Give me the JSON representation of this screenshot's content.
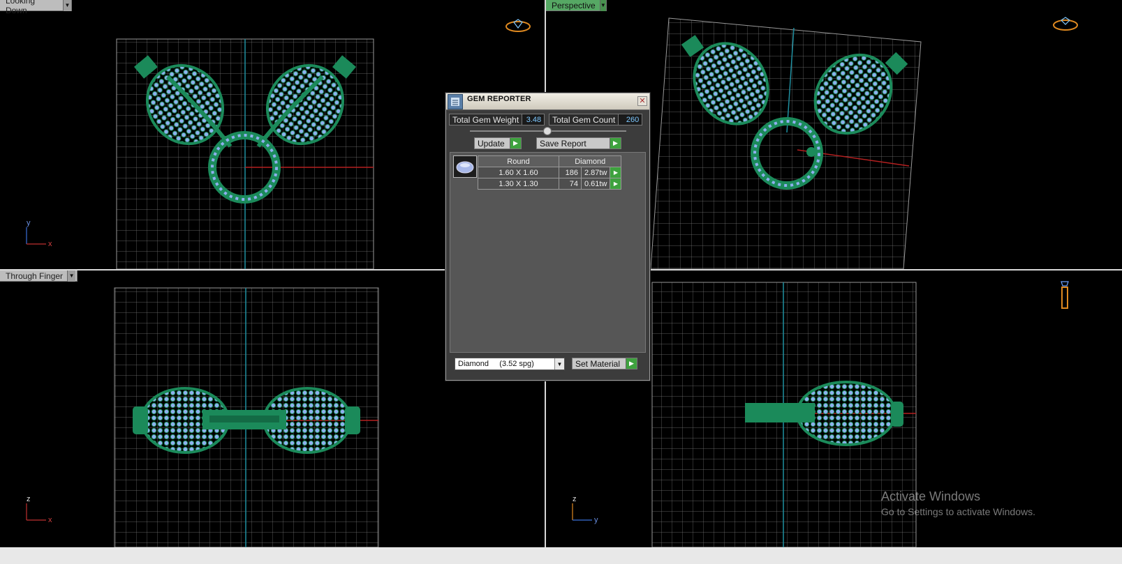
{
  "viewports": {
    "top_left": {
      "label": "Looking Down",
      "axes": {
        "vertical": "y",
        "horizontal": "x"
      }
    },
    "top_right": {
      "label": "Perspective"
    },
    "bottom_left": {
      "label": "Through Finger",
      "axes": {
        "vertical": "z",
        "horizontal": "x"
      }
    },
    "bottom_right": {
      "label": "",
      "axes": {
        "vertical": "z",
        "horizontal": "y"
      }
    }
  },
  "gem_reporter": {
    "title": "GEM REPORTER",
    "total_weight_label": "Total Gem Weight",
    "total_weight_value": "3.48",
    "total_count_label": "Total Gem Count",
    "total_count_value": "260",
    "update_label": "Update",
    "save_report_label": "Save Report",
    "table": {
      "shape": "Round",
      "material": "Diamond",
      "rows": [
        {
          "size": "1.60 X 1.60",
          "count": "186",
          "weight": "2.87tw"
        },
        {
          "size": "1.30 X 1.30",
          "count": "74",
          "weight": "0.61tw"
        }
      ]
    },
    "material_select": "Diamond     (3.52 spg)",
    "set_material_label": "Set Material"
  },
  "watermark": {
    "line1": "Activate Windows",
    "line2": "Go to Settings to activate Windows."
  },
  "colors": {
    "metal": "#1b8a5a",
    "gem": "#8fb0f0",
    "grid": "#8a8a8a",
    "axis_cyan": "#1f8fa0",
    "axis_red": "#b52020",
    "active_tab": "#56a864"
  }
}
